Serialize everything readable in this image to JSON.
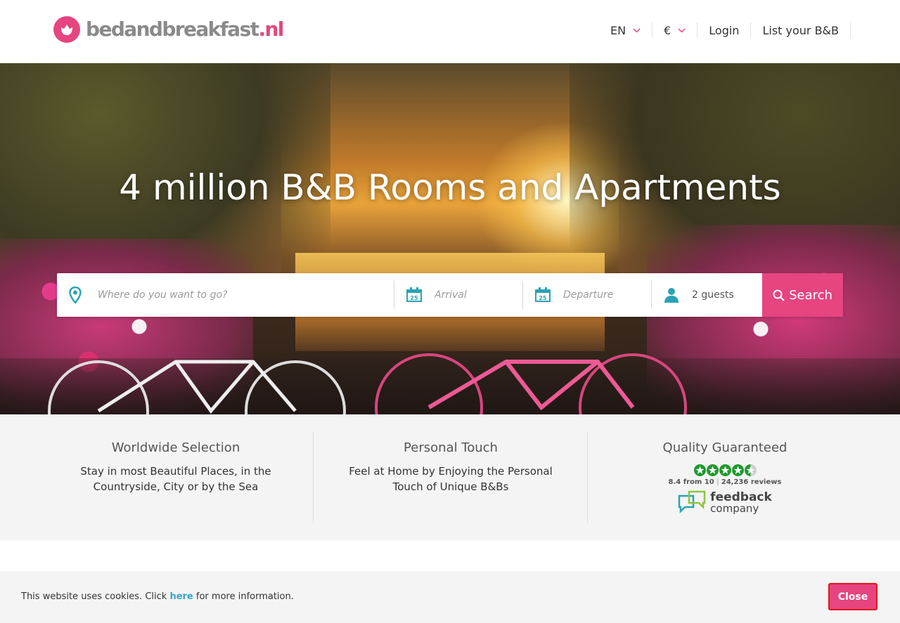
{
  "brand": {
    "logo_prefix": "bedandbreakfast",
    "logo_suffix": ".nl",
    "accent": "#e6457f"
  },
  "nav": {
    "language": "EN",
    "currency": "€",
    "login": "Login",
    "list_bnb": "List your B&B"
  },
  "hero": {
    "title": "4 million B&B Rooms and Apartments"
  },
  "search": {
    "where_placeholder": "Where do you want to go?",
    "arrival_placeholder": "Arrival",
    "departure_placeholder": "Departure",
    "guests_value": "2 guests",
    "button_label": "Search"
  },
  "features": [
    {
      "title": "Worldwide Selection",
      "text": "Stay in most Beautiful Places, in the Countryside, City or by the Sea"
    },
    {
      "title": "Personal Touch",
      "text": "Feel at Home by Enjoying the Personal Touch of Unique B&Bs"
    },
    {
      "title": "Quality Guaranteed",
      "rating_text": "8.4 from 10",
      "reviews_text": "24,236 reviews",
      "feedback_line1": "feedback",
      "feedback_line2": "company",
      "stars": 4.5
    }
  ],
  "cookie": {
    "text_before": "This website uses cookies. Click ",
    "link": "here",
    "text_after": " for more information.",
    "close_label": "Close"
  }
}
